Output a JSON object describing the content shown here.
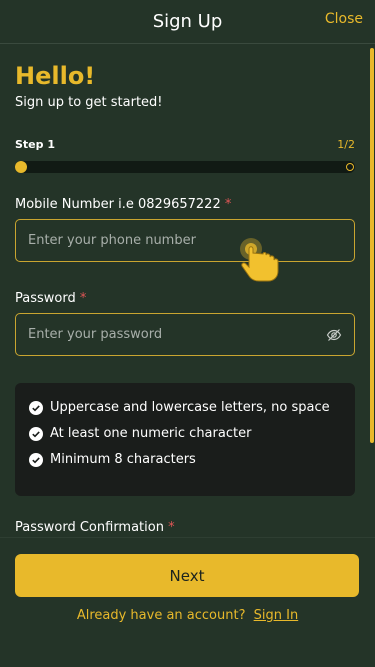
{
  "header": {
    "title": "Sign Up",
    "close_label": "Close"
  },
  "intro": {
    "greeting": "Hello!",
    "subtitle": "Sign up to get started!"
  },
  "progress": {
    "step_label": "Step 1",
    "step_count": "1/2",
    "current_step": 1,
    "total_steps": 2
  },
  "form": {
    "mobile": {
      "label": "Mobile Number i.e 0829657222",
      "required_mark": "*",
      "placeholder": "Enter your phone number",
      "value": ""
    },
    "password": {
      "label": "Password",
      "required_mark": "*",
      "placeholder": "Enter your password",
      "value": "",
      "toggle_icon": "eye-off-icon"
    },
    "password_rules": [
      {
        "icon": "check-circle-icon",
        "text": "Uppercase and lowercase letters, no space"
      },
      {
        "icon": "check-circle-icon",
        "text": "At least one numeric character"
      },
      {
        "icon": "check-circle-icon",
        "text": "Minimum 8 characters"
      }
    ],
    "password_confirmation": {
      "label": "Password Confirmation",
      "required_mark": "*"
    }
  },
  "footer": {
    "next_label": "Next",
    "account_prompt": "Already have an account?",
    "signin_label": "Sign In"
  },
  "colors": {
    "background": "#243428",
    "accent": "#e8b92b",
    "required": "#e05656",
    "rules_box": "#1a1d1b"
  }
}
